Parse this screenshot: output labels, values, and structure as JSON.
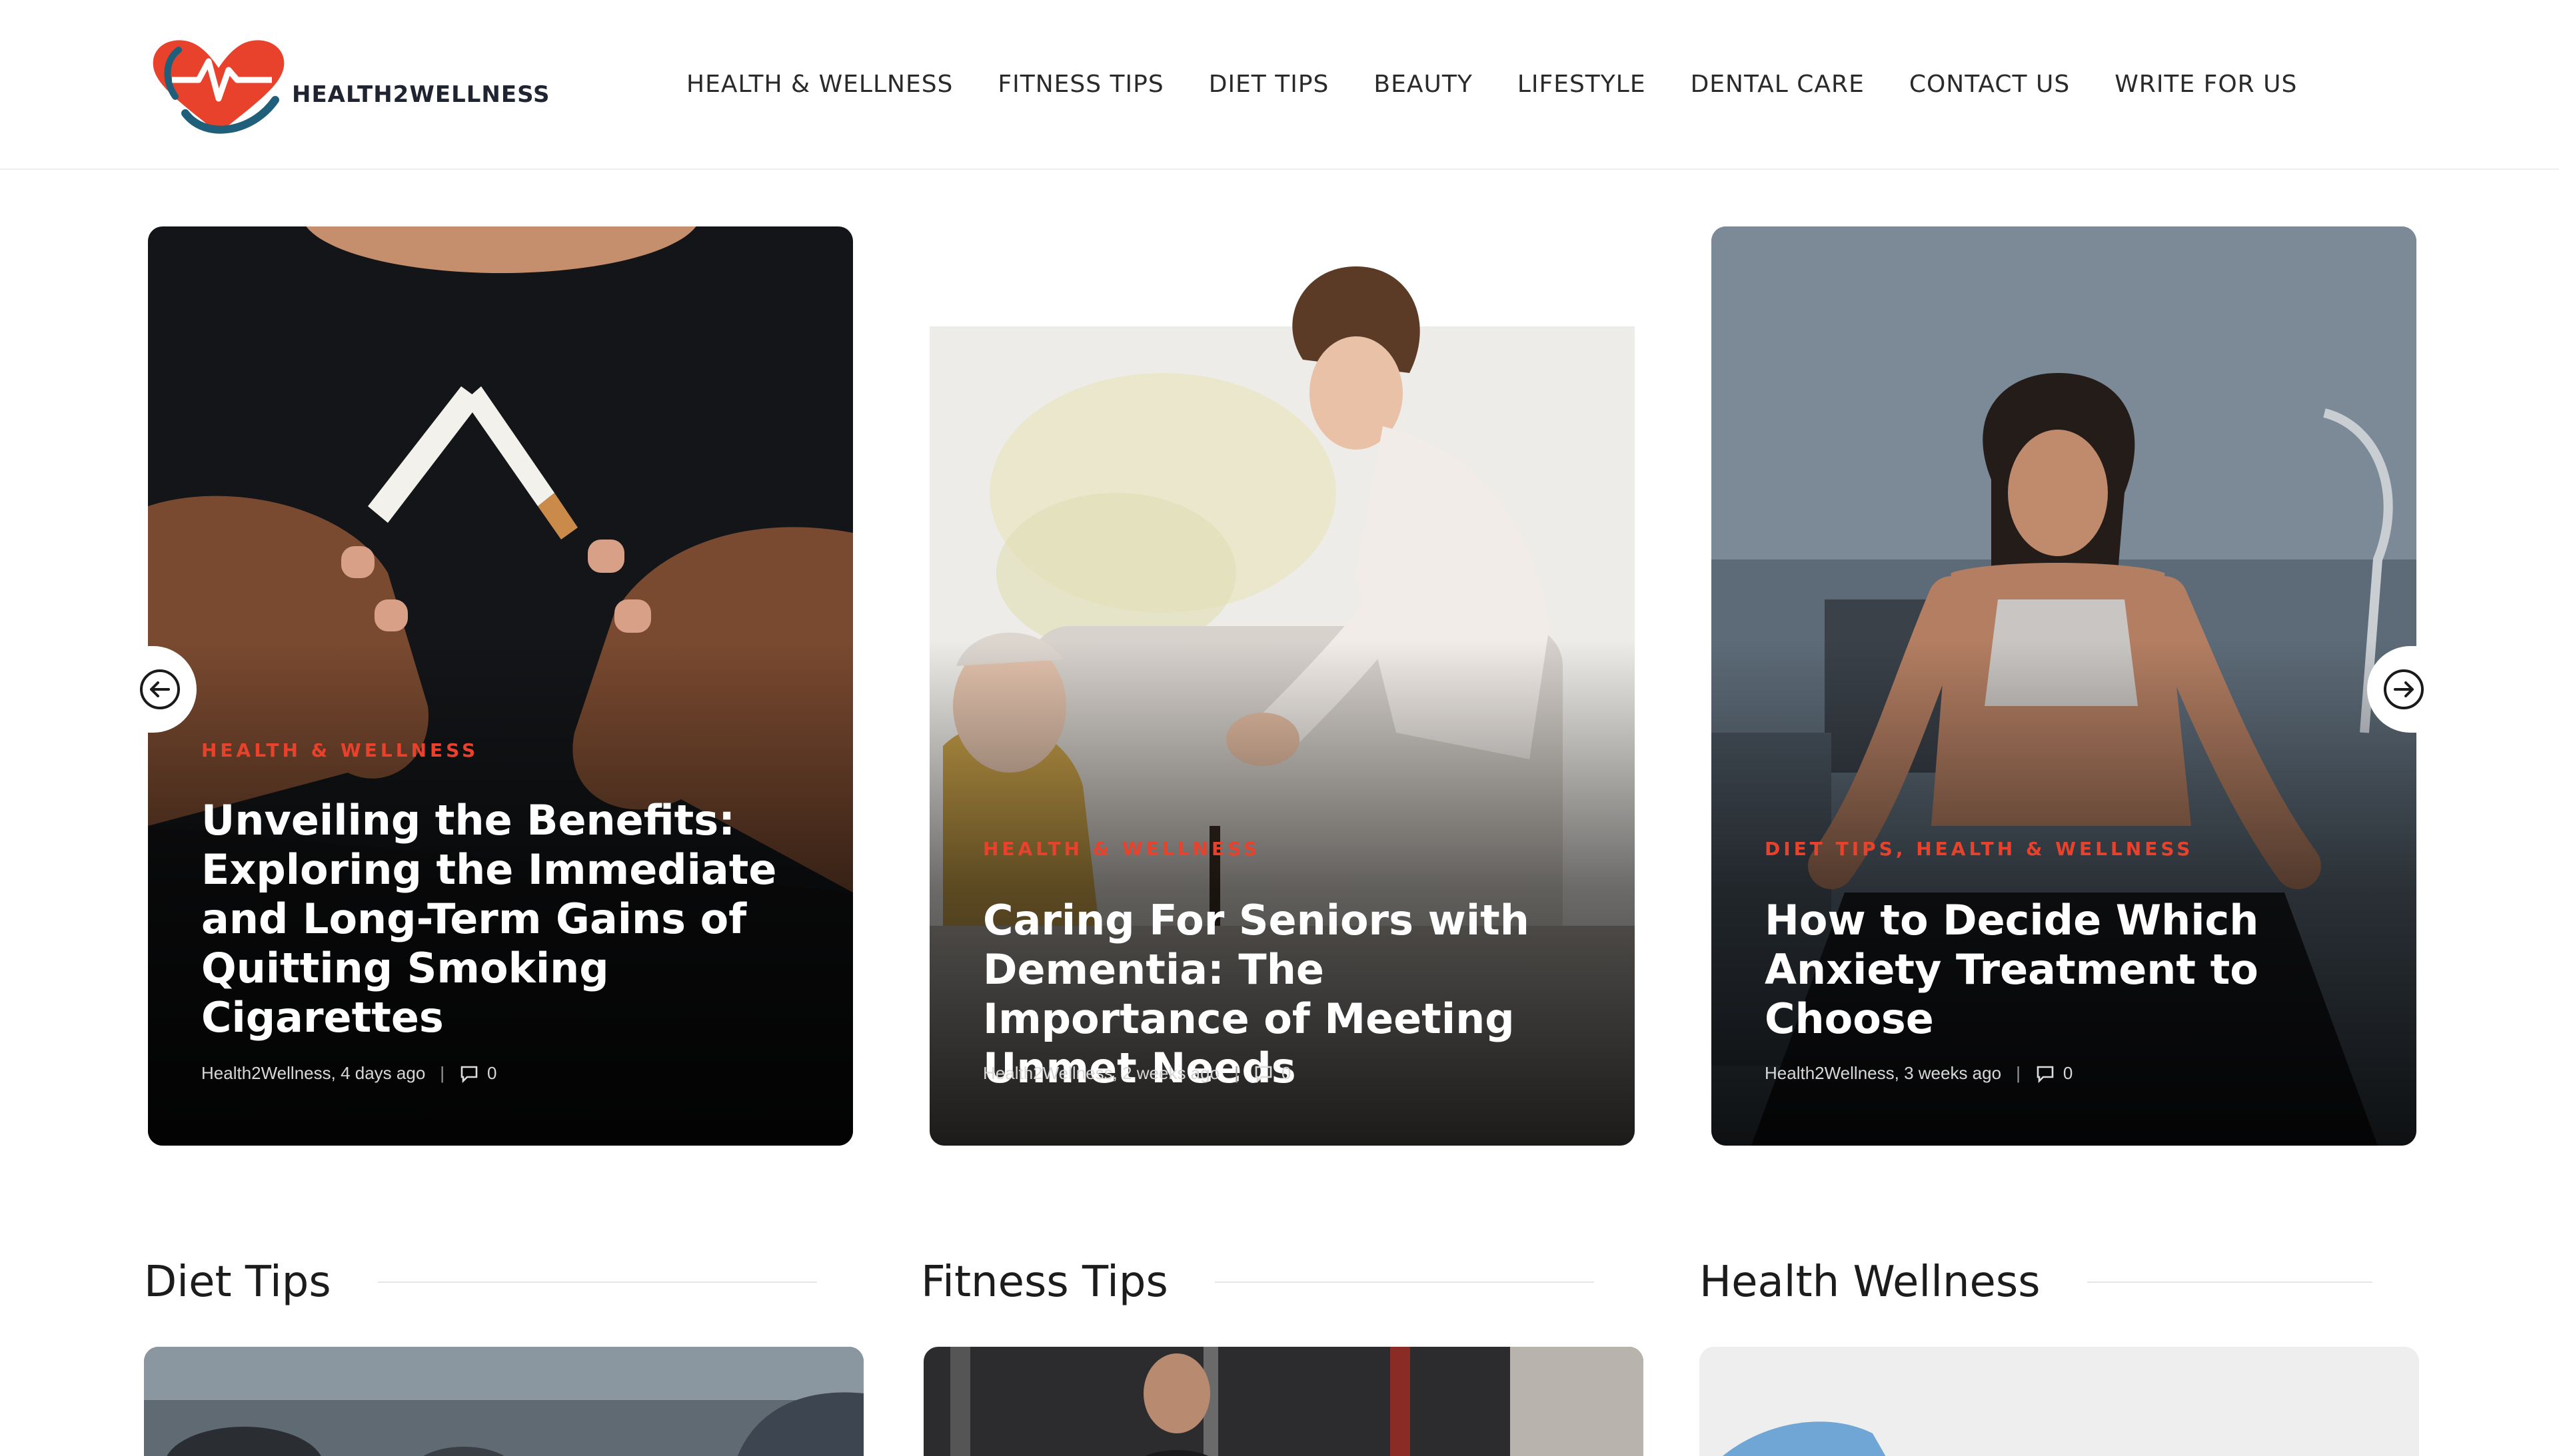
{
  "site": {
    "logo_text": "HEALTH2WELLNESS",
    "brand_color": "#e8412c",
    "logo_accent": "#1f5f7a"
  },
  "nav": {
    "items": [
      {
        "label": "HEALTH & WELLNESS"
      },
      {
        "label": "FITNESS TIPS"
      },
      {
        "label": "DIET TIPS"
      },
      {
        "label": "BEAUTY"
      },
      {
        "label": "LIFESTYLE"
      },
      {
        "label": "DENTAL CARE"
      },
      {
        "label": "CONTACT US"
      },
      {
        "label": "WRITE FOR US"
      }
    ]
  },
  "slider": {
    "prev_icon": "arrow-left-circle-icon",
    "next_icon": "arrow-right-circle-icon",
    "cards": [
      {
        "category": "HEALTH & WELLNESS",
        "title": "Unveiling the Benefits: Exploring the Immediate and Long-Term Gains of Quitting Smoking Cigarettes",
        "author_date": "Health2Wellness, 4 days ago",
        "comments": "0",
        "image": "hands breaking cigarette"
      },
      {
        "category": "HEALTH & WELLNESS",
        "title": "Caring For Seniors with Dementia: The Importance of Meeting Unmet Needs",
        "author_date": "Health2Wellness, 2 weeks ago",
        "comments": "0",
        "image": "caregiver helping senior woman"
      },
      {
        "category": "DIET TIPS, HEALTH & WELLNESS",
        "title": "How to Decide Which Anxiety Treatment to Choose",
        "author_date": "Health2Wellness, 3 weeks ago",
        "comments": "0",
        "image": "woman meditating"
      }
    ]
  },
  "sections": [
    {
      "title": "Diet Tips"
    },
    {
      "title": "Fitness Tips"
    },
    {
      "title": "Health Wellness"
    }
  ]
}
